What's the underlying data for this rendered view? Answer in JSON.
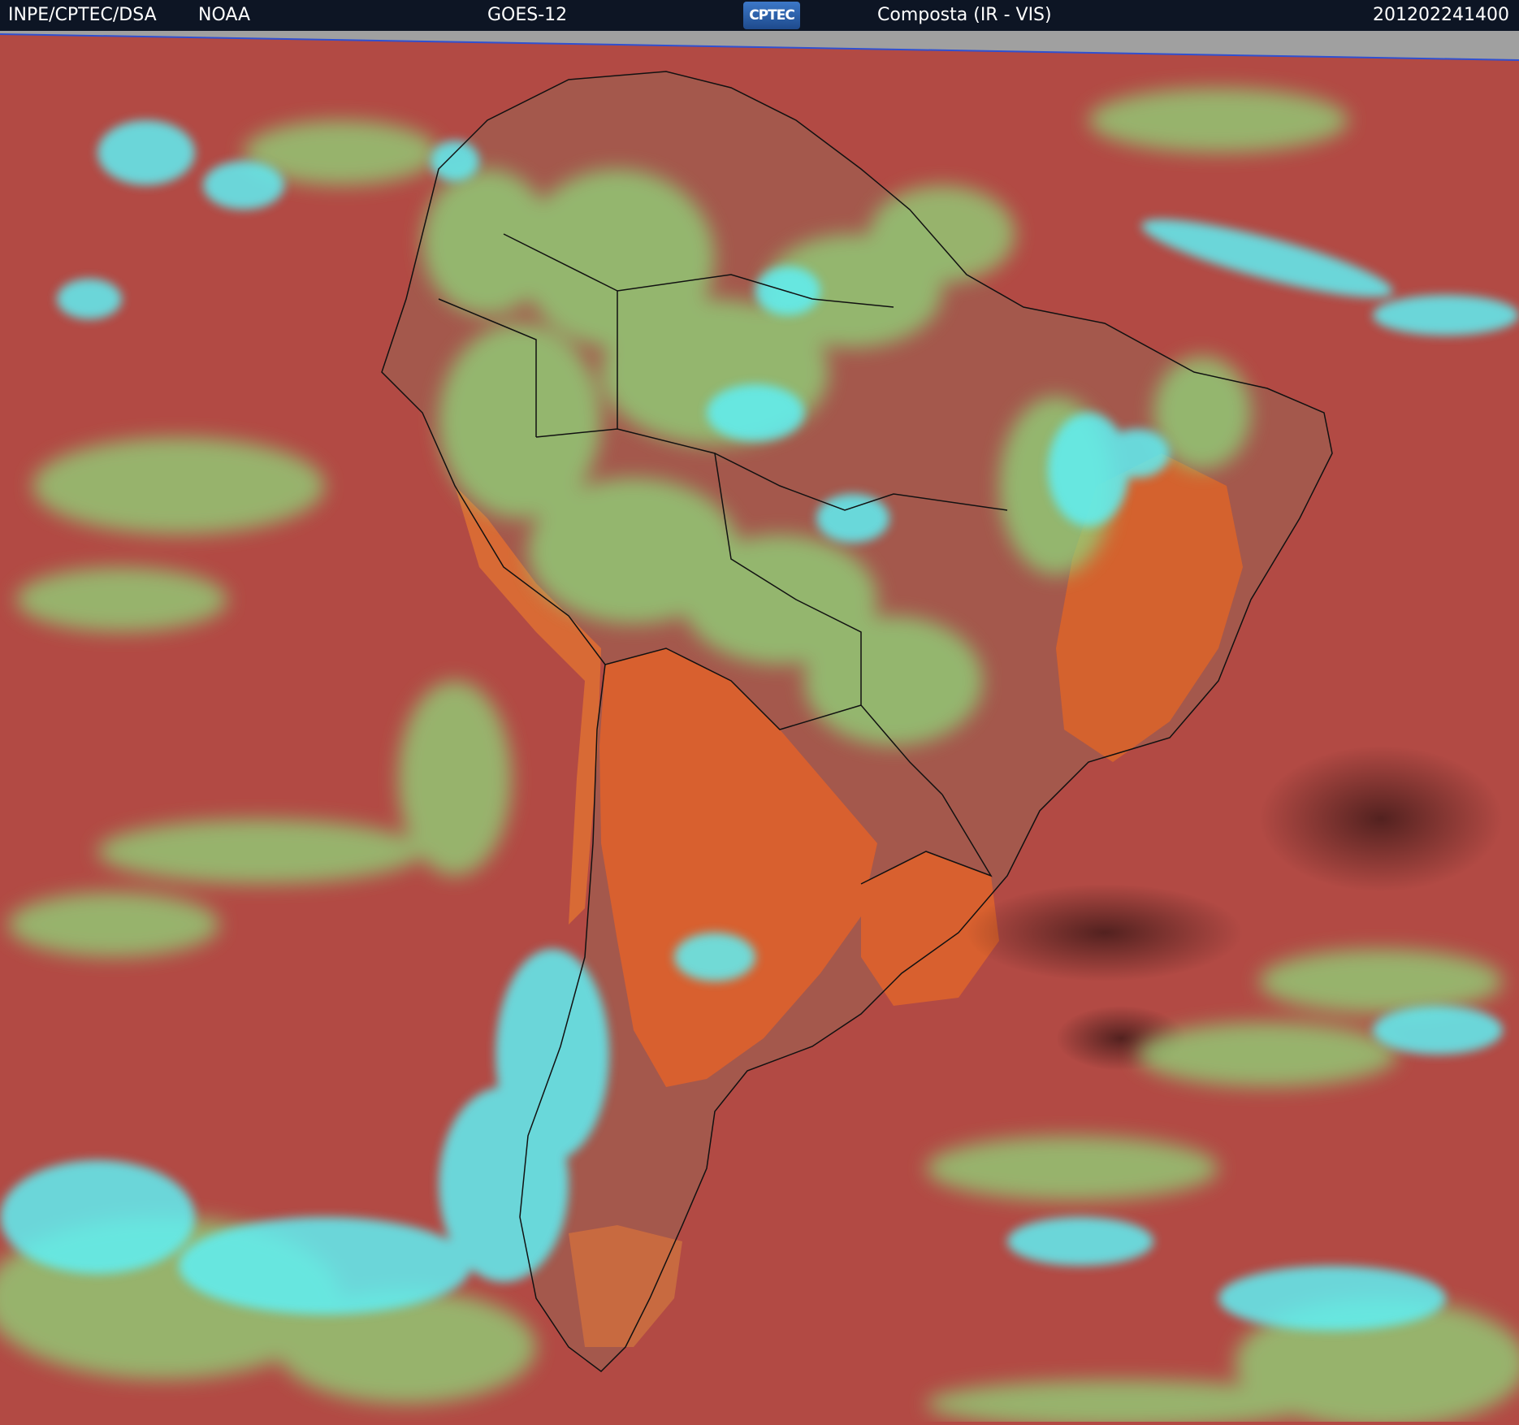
{
  "header": {
    "agency": "INPE/CPTEC/DSA",
    "partner": "NOAA",
    "satellite": "GOES-12",
    "logo_text": "CPTEC",
    "product": "Composta (IR - VIS)",
    "timestamp": "201202241400"
  },
  "map": {
    "region": "South America",
    "colors": {
      "ocean_clear": "#b24a44",
      "land_warm": "#d8602f",
      "cloud_low": "#8fd67a",
      "cloud_high": "#5ef0f5",
      "no_data": "#a0a0a0",
      "border": "#111111",
      "header_bg": "#0d1524"
    }
  }
}
